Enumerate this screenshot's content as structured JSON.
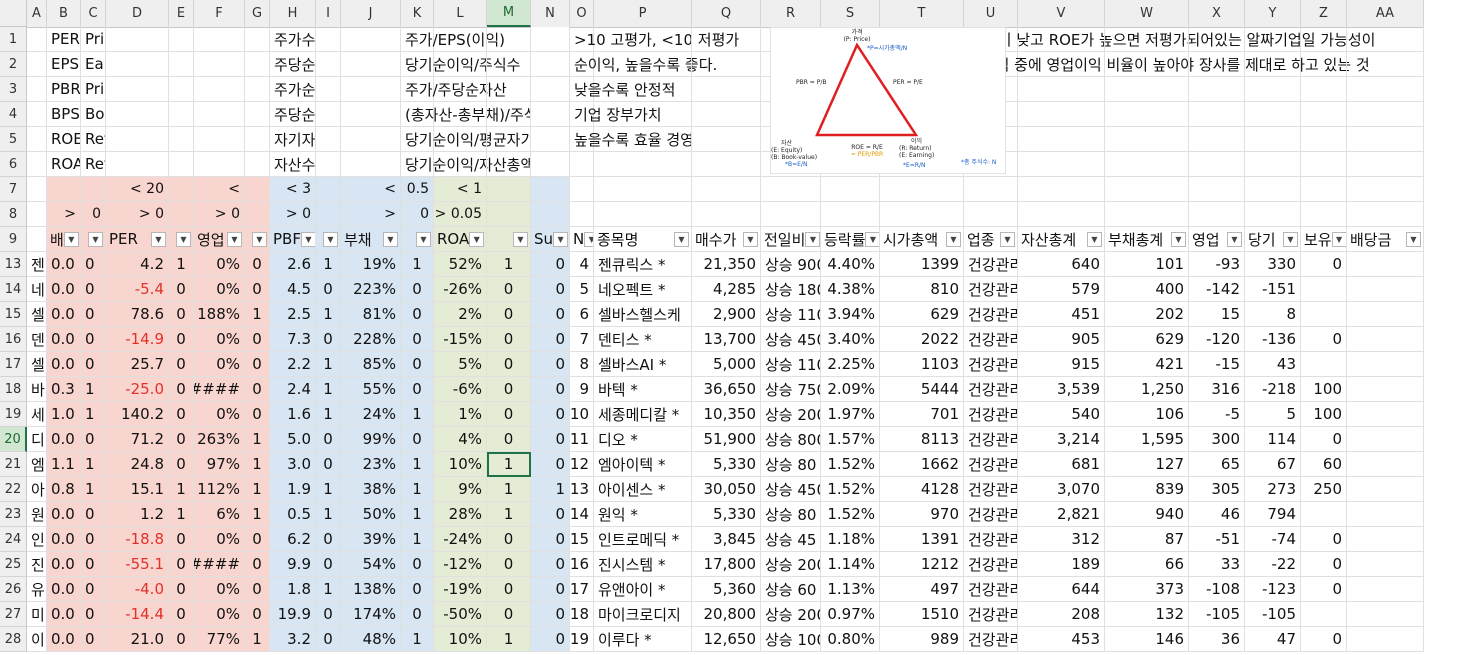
{
  "columns": [
    "A",
    "B",
    "C",
    "D",
    "E",
    "F",
    "G",
    "H",
    "I",
    "J",
    "K",
    "L",
    "M",
    "N",
    "O",
    "P",
    "Q",
    "R",
    "S",
    "T",
    "U",
    "V",
    "W",
    "X",
    "Y",
    "Z",
    "AA"
  ],
  "selected_column": "M",
  "selected_row": "20",
  "colors": {
    "pink": "#f8d6cf",
    "blue": "#d8e6f4",
    "green": "#e4ecd5",
    "negative": "#e0312b",
    "select": "#217346"
  },
  "diagram": {
    "top": "가격",
    "top_sub": "(P: Price)",
    "p_formula": "*P=시가총액/N",
    "pbr": "PBR = P/B",
    "per": "PER = P/E",
    "bl1": "자산",
    "bl2": "(E: Equity)",
    "bl3": "(B: Book-value)",
    "bl4": "*B=E/N",
    "roe": "ROE = R/E",
    "roe_alt": "= PER/PBR",
    "br1": "이익",
    "br2": "(R: Return)",
    "br3": "(E: Earning)",
    "br4": "*E=R/N",
    "footnote": "*총 주식수: N"
  },
  "rows": [
    {
      "num": "1",
      "cells": [
        "",
        "PER",
        "Price Earning Ratio",
        "",
        "",
        "",
        "",
        "주가수익비율",
        "",
        "",
        "주가/EPS(이익)",
        "",
        "",
        "",
        ">10 고평가, <10 저평가",
        "",
        "",
        "",
        "",
        "",
        "PBR이 낮고 ROE가 높으면 저평가되어있는 알짜기업일 가능성이",
        "",
        "",
        "",
        "",
        "",
        ""
      ]
    },
    {
      "num": "2",
      "cells": [
        "",
        "EPS",
        "Earning Per Share",
        "",
        "",
        "",
        "",
        "주당순이익",
        "",
        "",
        "당기순이익/주식수",
        "",
        "",
        "",
        "순이익, 높을수록 좋다.",
        "",
        "",
        "",
        "",
        "",
        "순이익 중에 영업이익 비율이 높아야 장사를 제대로 하고 있는 것",
        "",
        "",
        "",
        "",
        "",
        ""
      ]
    },
    {
      "num": "3",
      "cells": [
        "",
        "PBR",
        "Price Book-value Ratio",
        "",
        "",
        "",
        "",
        "주가순자산비율",
        "",
        "",
        "주가/주당순자산",
        "",
        "",
        "",
        "낮을수록 안정적",
        "",
        "",
        "",
        "",
        "",
        "",
        "",
        "",
        "",
        "",
        "",
        ""
      ]
    },
    {
      "num": "4",
      "cells": [
        "",
        "BPS",
        "Book-value Per Share",
        "",
        "",
        "",
        "",
        "주당순자산",
        "",
        "",
        "(총자산-총부채)/주식수",
        "",
        "",
        "",
        "기업 장부가치",
        "",
        "",
        "",
        "",
        "",
        "",
        "",
        "",
        "",
        "",
        "",
        ""
      ]
    },
    {
      "num": "5",
      "cells": [
        "",
        "ROE",
        "Return On equity",
        "",
        "",
        "",
        "",
        "자기자본이익률",
        "",
        "",
        "당기순이익/평균자기자본",
        "",
        "",
        "",
        "높을수록 효율 경영",
        "",
        "",
        "",
        "",
        "",
        "",
        "",
        "",
        "",
        "",
        "",
        ""
      ]
    },
    {
      "num": "6",
      "cells": [
        "",
        "ROA",
        "Return On Assets",
        "",
        "",
        "",
        "",
        "자산수익률",
        "",
        "",
        "당기순이익/자산총액",
        "",
        "",
        "",
        "",
        "",
        "",
        "",
        "",
        "",
        "",
        "",
        "",
        "",
        "",
        "",
        ""
      ]
    },
    {
      "num": "7",
      "cells": [
        "",
        "",
        "",
        "< 20",
        "",
        "<",
        "",
        "< 3",
        "",
        "<",
        "0.5",
        "< 1",
        "",
        "",
        "",
        "",
        "",
        "",
        "",
        "",
        "",
        "",
        "",
        "",
        "",
        "",
        ""
      ]
    },
    {
      "num": "8",
      "cells": [
        "",
        ">",
        "0",
        "> 0",
        "",
        "> 0",
        "",
        "> 0",
        "",
        ">",
        "0",
        "> 0.05",
        "",
        "",
        "",
        "",
        "",
        "",
        "",
        "",
        "",
        "",
        "",
        "",
        "",
        "",
        ""
      ]
    },
    {
      "num": "9",
      "cells": [
        "",
        "배",
        "",
        "PER",
        "",
        "영업",
        "",
        "PBF",
        "",
        "부채",
        "",
        "ROA",
        "",
        "Su",
        "N",
        "종목명",
        "매수가",
        "전일비",
        "등락률",
        "시가총액",
        "업종",
        "자산총계",
        "부채총계",
        "영업",
        "당기",
        "보유",
        "배당금"
      ]
    },
    {
      "num": "13",
      "cells": [
        "젠",
        "0.0",
        "0",
        "4.2",
        "1",
        "0%",
        "0",
        "2.6",
        "1",
        "19%",
        "1",
        "52%",
        "1",
        "0",
        "4",
        "젠큐릭스 *",
        "21,350",
        "상승 900",
        "4.40%",
        "1399",
        "건강관리",
        "640",
        "101",
        "-93",
        "330",
        "0",
        ""
      ]
    },
    {
      "num": "14",
      "cells": [
        "네",
        "0.0",
        "0",
        "-5.4",
        "0",
        "0%",
        "0",
        "4.5",
        "0",
        "223%",
        "0",
        "-26%",
        "0",
        "0",
        "5",
        "네오펙트 *",
        "4,285",
        "상승 180",
        "4.38%",
        "810",
        "건강관리",
        "579",
        "400",
        "-142",
        "-151",
        "",
        ""
      ]
    },
    {
      "num": "15",
      "cells": [
        "셀",
        "0.0",
        "0",
        "78.6",
        "0",
        "188%",
        "1",
        "2.5",
        "1",
        "81%",
        "0",
        "2%",
        "0",
        "0",
        "6",
        "셀바스헬스케",
        "2,900",
        "상승 110",
        "3.94%",
        "629",
        "건강관리",
        "451",
        "202",
        "15",
        "8",
        "",
        ""
      ]
    },
    {
      "num": "16",
      "cells": [
        "덴",
        "0.0",
        "0",
        "-14.9",
        "0",
        "0%",
        "0",
        "7.3",
        "0",
        "228%",
        "0",
        "-15%",
        "0",
        "0",
        "7",
        "덴티스 *",
        "13,700",
        "상승 450",
        "3.40%",
        "2022",
        "건강관리",
        "905",
        "629",
        "-120",
        "-136",
        "0",
        ""
      ]
    },
    {
      "num": "17",
      "cells": [
        "셀",
        "0.0",
        "0",
        "25.7",
        "0",
        "0%",
        "0",
        "2.2",
        "1",
        "85%",
        "0",
        "5%",
        "0",
        "0",
        "8",
        "셀바스AI *",
        "5,000",
        "상승 110",
        "2.25%",
        "1103",
        "건강관리",
        "915",
        "421",
        "-15",
        "43",
        "",
        ""
      ]
    },
    {
      "num": "18",
      "cells": [
        "바",
        "0.3",
        "1",
        "-25.0",
        "0",
        "####",
        "0",
        "2.4",
        "1",
        "55%",
        "0",
        "-6%",
        "0",
        "0",
        "9",
        "바텍 *",
        "36,650",
        "상승 750",
        "2.09%",
        "5444",
        "건강관리",
        "3,539",
        "1,250",
        "316",
        "-218",
        "100",
        ""
      ]
    },
    {
      "num": "19",
      "cells": [
        "세",
        "1.0",
        "1",
        "140.2",
        "0",
        "0%",
        "0",
        "1.6",
        "1",
        "24%",
        "1",
        "1%",
        "0",
        "0",
        "10",
        "세종메디칼 *",
        "10,350",
        "상승 200",
        "1.97%",
        "701",
        "건강관리",
        "540",
        "106",
        "-5",
        "5",
        "100",
        ""
      ]
    },
    {
      "num": "20",
      "cells": [
        "디",
        "0.0",
        "0",
        "71.2",
        "0",
        "263%",
        "1",
        "5.0",
        "0",
        "99%",
        "0",
        "4%",
        "0",
        "0",
        "11",
        "디오 *",
        "51,900",
        "상승 800",
        "1.57%",
        "8113",
        "건강관리",
        "3,214",
        "1,595",
        "300",
        "114",
        "0",
        ""
      ]
    },
    {
      "num": "21",
      "cells": [
        "엠",
        "1.1",
        "1",
        "24.8",
        "0",
        "97%",
        "1",
        "3.0",
        "0",
        "23%",
        "1",
        "10%",
        "1",
        "0",
        "12",
        "엠아이텍 *",
        "5,330",
        "상승 80",
        "1.52%",
        "1662",
        "건강관리",
        "681",
        "127",
        "65",
        "67",
        "60",
        ""
      ]
    },
    {
      "num": "22",
      "cells": [
        "아",
        "0.8",
        "1",
        "15.1",
        "1",
        "112%",
        "1",
        "1.9",
        "1",
        "38%",
        "1",
        "9%",
        "1",
        "1",
        "13",
        "아이센스 *",
        "30,050",
        "상승 450",
        "1.52%",
        "4128",
        "건강관리",
        "3,070",
        "839",
        "305",
        "273",
        "250",
        ""
      ]
    },
    {
      "num": "23",
      "cells": [
        "원",
        "0.0",
        "0",
        "1.2",
        "1",
        "6%",
        "1",
        "0.5",
        "1",
        "50%",
        "1",
        "28%",
        "1",
        "0",
        "14",
        "원익 *",
        "5,330",
        "상승 80",
        "1.52%",
        "970",
        "건강관리",
        "2,821",
        "940",
        "46",
        "794",
        "",
        ""
      ]
    },
    {
      "num": "24",
      "cells": [
        "인",
        "0.0",
        "0",
        "-18.8",
        "0",
        "0%",
        "0",
        "6.2",
        "0",
        "39%",
        "1",
        "-24%",
        "0",
        "0",
        "15",
        "인트로메딕 *",
        "3,845",
        "상승 45",
        "1.18%",
        "1391",
        "건강관리",
        "312",
        "87",
        "-51",
        "-74",
        "0",
        ""
      ]
    },
    {
      "num": "25",
      "cells": [
        "진",
        "0.0",
        "0",
        "-55.1",
        "0",
        "####",
        "0",
        "9.9",
        "0",
        "54%",
        "0",
        "-12%",
        "0",
        "0",
        "16",
        "진시스템 *",
        "17,800",
        "상승 200",
        "1.14%",
        "1212",
        "건강관리",
        "189",
        "66",
        "33",
        "-22",
        "0",
        ""
      ]
    },
    {
      "num": "26",
      "cells": [
        "유",
        "0.0",
        "0",
        "-4.0",
        "0",
        "0%",
        "0",
        "1.8",
        "1",
        "138%",
        "0",
        "-19%",
        "0",
        "0",
        "17",
        "유앤아이 *",
        "5,360",
        "상승 60",
        "1.13%",
        "497",
        "건강관리",
        "644",
        "373",
        "-108",
        "-123",
        "0",
        ""
      ]
    },
    {
      "num": "27",
      "cells": [
        "미",
        "0.0",
        "0",
        "-14.4",
        "0",
        "0%",
        "0",
        "19.9",
        "0",
        "174%",
        "0",
        "-50%",
        "0",
        "0",
        "18",
        "마이크로디지",
        "20,800",
        "상승 200",
        "0.97%",
        "1510",
        "건강관리",
        "208",
        "132",
        "-105",
        "-105",
        "",
        ""
      ]
    },
    {
      "num": "28",
      "cells": [
        "이",
        "0.0",
        "0",
        "21.0",
        "0",
        "77%",
        "1",
        "3.2",
        "0",
        "48%",
        "1",
        "10%",
        "1",
        "0",
        "19",
        "이루다 *",
        "12,650",
        "상승 100",
        "0.80%",
        "989",
        "건강관리",
        "453",
        "146",
        "36",
        "47",
        "0",
        ""
      ]
    }
  ]
}
